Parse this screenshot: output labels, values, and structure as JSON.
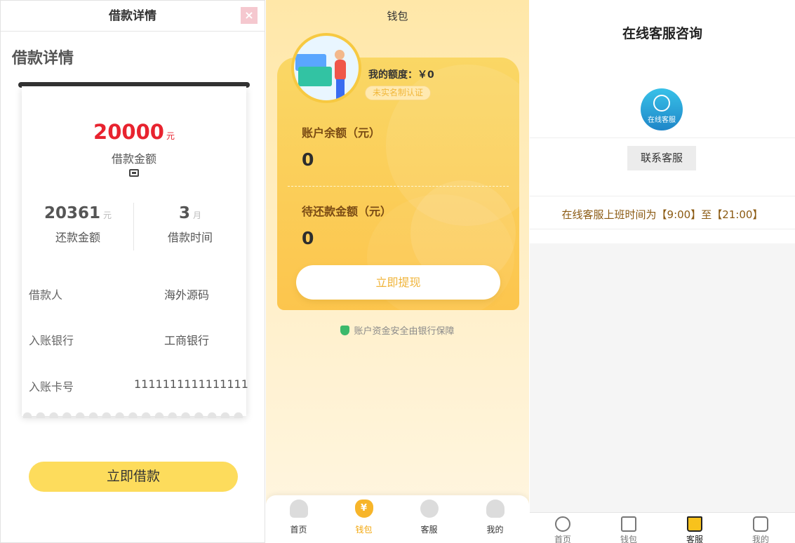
{
  "loan": {
    "header_title": "借款详情",
    "close_glyph": "×",
    "page_title": "借款详情",
    "amount": "20000",
    "amount_unit": "元",
    "amount_label": "借款金额",
    "repay_amount": "20361",
    "repay_unit": "元",
    "repay_label": "还款金额",
    "term": "3",
    "term_unit": "月",
    "term_label": "借款时间",
    "rows": [
      {
        "label": "借款人",
        "value": "海外源码"
      },
      {
        "label": "入账银行",
        "value": "工商银行"
      },
      {
        "label": "入账卡号",
        "value": "1111111111111111"
      }
    ],
    "apply_button": "立即借款",
    "accent_color": "#e8232f",
    "button_color": "#fddc5c"
  },
  "wallet": {
    "title": "钱包",
    "quota_label": "我的额度：￥0",
    "verify_badge": "未实名制认证",
    "balance_label": "账户余额（元）",
    "balance_value": "0",
    "due_label": "待还款金额（元）",
    "due_value": "0",
    "withdraw_button": "立即提现",
    "safety_note": "账户资金安全由银行保障",
    "card_color": "#fbd25c",
    "tabs": [
      {
        "label": "首页",
        "icon": "home-icon",
        "active": false
      },
      {
        "label": "钱包",
        "icon": "wallet-icon",
        "active": true
      },
      {
        "label": "客服",
        "icon": "service-icon",
        "active": false
      },
      {
        "label": "我的",
        "icon": "profile-icon",
        "active": false
      }
    ]
  },
  "service": {
    "title": "在线客服咨询",
    "icon_text": "在线客服",
    "contact_button": "联系客服",
    "hours": "在线客服上班时间为【9:00】至【21:00】",
    "tabs": [
      {
        "label": "首页",
        "icon": "home-icon",
        "active": false
      },
      {
        "label": "钱包",
        "icon": "wallet-icon",
        "active": false
      },
      {
        "label": "客服",
        "icon": "crown-icon",
        "active": true
      },
      {
        "label": "我的",
        "icon": "profile-icon",
        "active": false
      }
    ]
  }
}
